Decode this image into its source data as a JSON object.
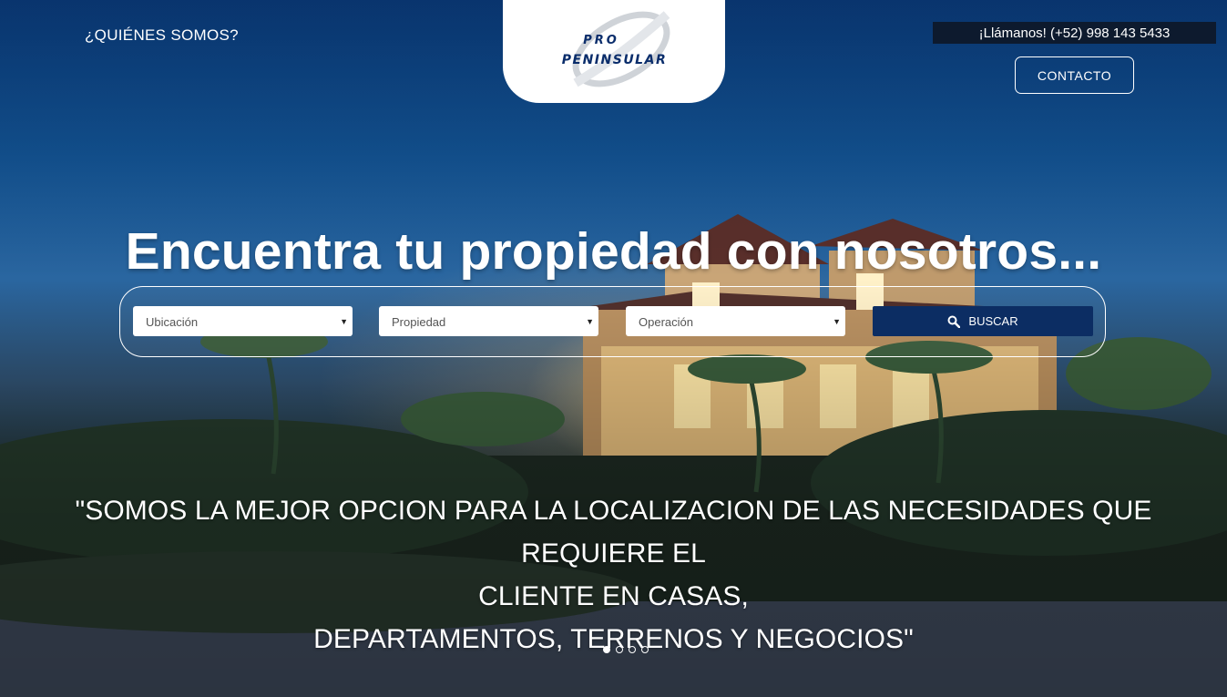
{
  "nav": {
    "about_label": "¿QUIÉNES SOMOS?"
  },
  "logo": {
    "line1": "PRO",
    "line2": "PENINSULAR"
  },
  "header": {
    "phone_text": "¡Llámanos! (+52) 998 143 5433",
    "contact_label": "CONTACTO"
  },
  "hero": {
    "headline": "Encuentra tu propiedad con nosotros...",
    "tagline_line1": "\"SOMOS LA MEJOR OPCION PARA LA LOCALIZACION DE LAS NECESIDADES QUE REQUIERE EL",
    "tagline_line2": "CLIENTE EN CASAS,",
    "tagline_line3": "DEPARTAMENTOS, TERRENOS Y NEGOCIOS\""
  },
  "search": {
    "location_value": "Ubicación",
    "property_value": "Propiedad",
    "operation_value": "Operación",
    "button_label": "BUSCAR"
  },
  "carousel": {
    "slide_count": 4,
    "active_index": 0
  },
  "colors": {
    "brand_navy": "#0c2d63",
    "phone_bg": "#0d1a2e",
    "logo_text": "#0a2d6b"
  },
  "icons": {
    "search": "search-icon",
    "select_caret": "caret-down-icon"
  }
}
